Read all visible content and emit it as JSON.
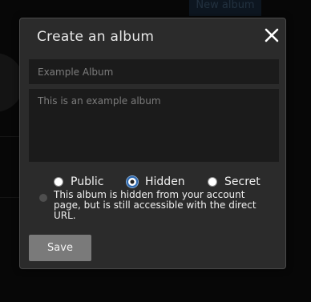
{
  "background": {
    "new_album_label": "New album"
  },
  "modal": {
    "title": "Create an album",
    "close_icon": "close-icon",
    "name_field": {
      "placeholder": "Example Album",
      "value": ""
    },
    "description_field": {
      "placeholder": "This is an example album",
      "value": ""
    },
    "visibility": {
      "selected": "Hidden",
      "options": [
        "Public",
        "Hidden",
        "Secret"
      ]
    },
    "info_text": "This album is hidden from your account page, but is still accessible with the direct URL.",
    "save_label": "Save"
  },
  "colors": {
    "modal_bg": "#2b2b2b",
    "input_bg": "#1b1b1b",
    "save_bg": "#7a7a7a",
    "radio_accent": "#2e6ab2"
  }
}
